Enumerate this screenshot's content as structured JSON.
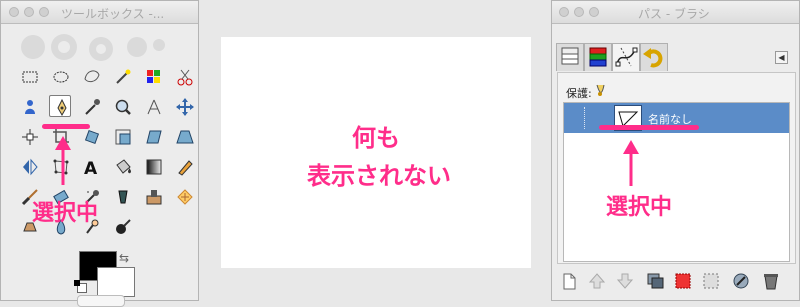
{
  "toolbox": {
    "title": "ツールボックス -...",
    "tools": [
      "rect-select-icon",
      "ellipse-select-icon",
      "free-select-icon",
      "fuzzy-select-icon",
      "color-select-icon",
      "scissors-icon",
      "foreground-select-icon",
      "paths-tool-icon",
      "color-picker-icon",
      "zoom-icon",
      "measure-icon",
      "move-icon",
      "align-icon",
      "crop-icon",
      "rotate-icon",
      "scale-icon",
      "shear-icon",
      "perspective-icon",
      "flip-icon",
      "cage-icon",
      "text-icon",
      "bucket-fill-icon",
      "blend-icon",
      "pencil-icon",
      "paintbrush-icon",
      "eraser-icon",
      "airbrush-icon",
      "ink-icon",
      "clone-icon",
      "heal-icon",
      "perspective-clone-icon",
      "blur-icon",
      "smudge-icon",
      "dodge-burn-icon"
    ],
    "selected_tool": "paths-tool-icon",
    "annotation": "選択中"
  },
  "canvas": {
    "annotation_line1": "何も",
    "annotation_line2": "表示されない"
  },
  "paths_dock": {
    "title": "パス - ブラシ",
    "tabs": [
      "layers-tab-icon",
      "channels-tab-icon",
      "paths-tab-icon",
      "undo-tab-icon"
    ],
    "active_tab": "paths-tab-icon",
    "lock_label": "保護:",
    "paths": [
      {
        "name": "名前なし",
        "selected": true
      }
    ],
    "annotation": "選択中",
    "buttons": [
      "new-path-icon",
      "raise-path-icon",
      "lower-path-icon",
      "duplicate-path-icon",
      "path-to-selection-icon",
      "selection-to-path-icon",
      "paint-along-path-icon",
      "delete-path-icon"
    ]
  },
  "colors": {
    "annotation": "#ff2d8a",
    "selection": "#5b8cc8"
  }
}
